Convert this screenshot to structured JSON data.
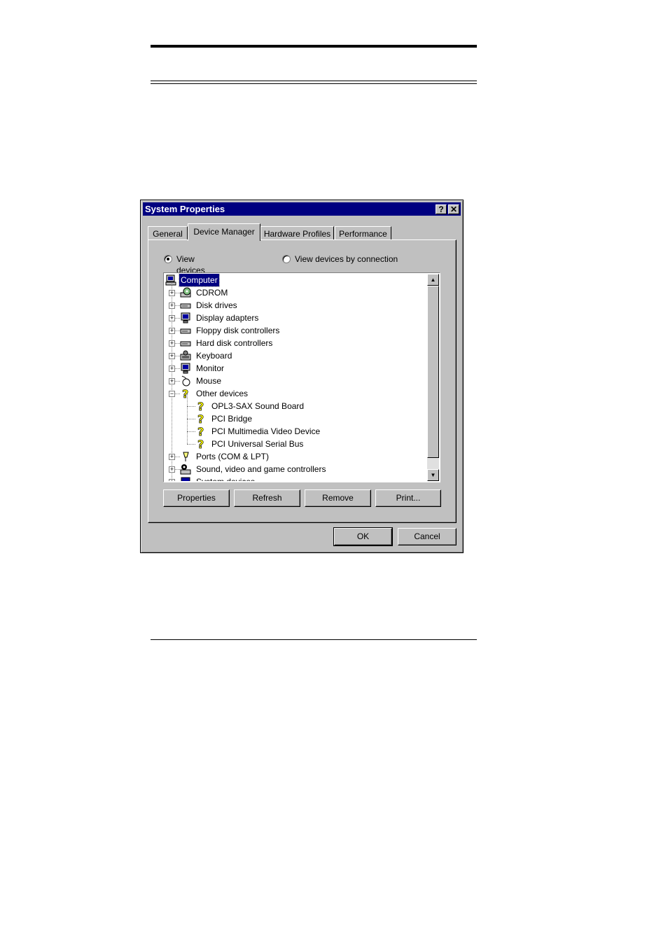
{
  "window": {
    "title": "System Properties",
    "help_label": "?",
    "close_label": "✕"
  },
  "tabs": [
    "General",
    "Device Manager",
    "Hardware Profiles",
    "Performance"
  ],
  "radios": {
    "by_type": {
      "label": "View devices by type",
      "checked": true
    },
    "by_connection": {
      "label": "View devices by connection",
      "checked": false
    }
  },
  "tree": {
    "root": "Computer",
    "items": [
      {
        "label": "CDROM",
        "icon": "cdrom-icon"
      },
      {
        "label": "Disk drives",
        "icon": "disk-drive-icon"
      },
      {
        "label": "Display adapters",
        "icon": "display-adapter-icon"
      },
      {
        "label": "Floppy disk controllers",
        "icon": "floppy-controller-icon"
      },
      {
        "label": "Hard disk controllers",
        "icon": "hard-disk-controller-icon"
      },
      {
        "label": "Keyboard",
        "icon": "keyboard-icon"
      },
      {
        "label": "Monitor",
        "icon": "monitor-icon"
      },
      {
        "label": "Mouse",
        "icon": "mouse-icon"
      },
      {
        "label": "Other devices",
        "icon": "unknown-device-icon",
        "expanded": true
      },
      {
        "label": "OPL3-SAX Sound Board",
        "icon": "unknown-device-icon",
        "child": true
      },
      {
        "label": "PCI Bridge",
        "icon": "unknown-device-icon",
        "child": true
      },
      {
        "label": "PCI Multimedia Video Device",
        "icon": "unknown-device-icon",
        "child": true
      },
      {
        "label": "PCI Universal Serial Bus",
        "icon": "unknown-device-icon",
        "child": true
      },
      {
        "label": "Ports (COM & LPT)",
        "icon": "port-icon"
      },
      {
        "label": "Sound, video and game controllers",
        "icon": "sound-controller-icon"
      },
      {
        "label": "System devices",
        "icon": "system-device-icon"
      }
    ]
  },
  "buttons": {
    "properties": "Properties",
    "refresh": "Refresh",
    "remove": "Remove",
    "print": "Print...",
    "ok": "OK",
    "cancel": "Cancel"
  },
  "colors": {
    "face": "#c0c0c0",
    "titlebar": "#000080",
    "selection": "#000080",
    "unknown_icon": "#ffff00"
  }
}
